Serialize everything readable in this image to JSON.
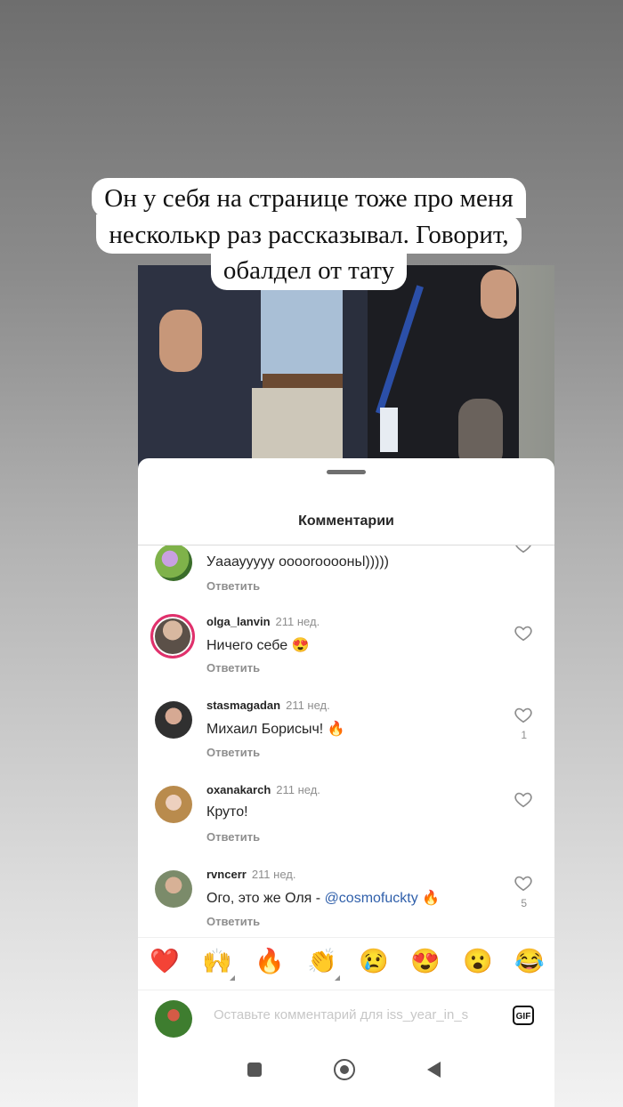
{
  "story": {
    "caption_lines": [
      "Он у себя на странице тоже про меня",
      "нескольκр раз рассказывал. Говорит,",
      "обалдел от тату"
    ]
  },
  "sheet": {
    "title": "Комментарии"
  },
  "comments": [
    {
      "username": "",
      "time": "",
      "text": "Уааауyyyy ооооrооооньl)))))",
      "reply_label": "Ответить",
      "likes": ""
    },
    {
      "username": "olga_lanvin",
      "time": "211 нед.",
      "text": "Ничего себе 😍",
      "reply_label": "Ответить",
      "likes": ""
    },
    {
      "username": "stasmagadan",
      "time": "211 нед.",
      "text": "Михаил Борисыч! 🔥",
      "reply_label": "Ответить",
      "likes": "1"
    },
    {
      "username": "oxanakarch",
      "time": "211 нед.",
      "text": "Круто!",
      "reply_label": "Ответить",
      "likes": ""
    },
    {
      "username": "rvncerr",
      "time": "211 нед.",
      "text_before": "Ого, это же Оля - ",
      "mention": "@cosmofuckty",
      "text_after": " 🔥",
      "reply_label": "Ответить",
      "likes": "5"
    }
  ],
  "reactions": [
    "❤️",
    "🙌",
    "🔥",
    "👏",
    "😢",
    "😍",
    "😮",
    "😂"
  ],
  "composer": {
    "placeholder": "Оставьте комментарий для iss_year_in_s",
    "gif_label": "GIF"
  },
  "colors": {
    "link": "#2f5faa",
    "story_ring": "#e1306c",
    "secondary_text": "#8e8e8e"
  }
}
